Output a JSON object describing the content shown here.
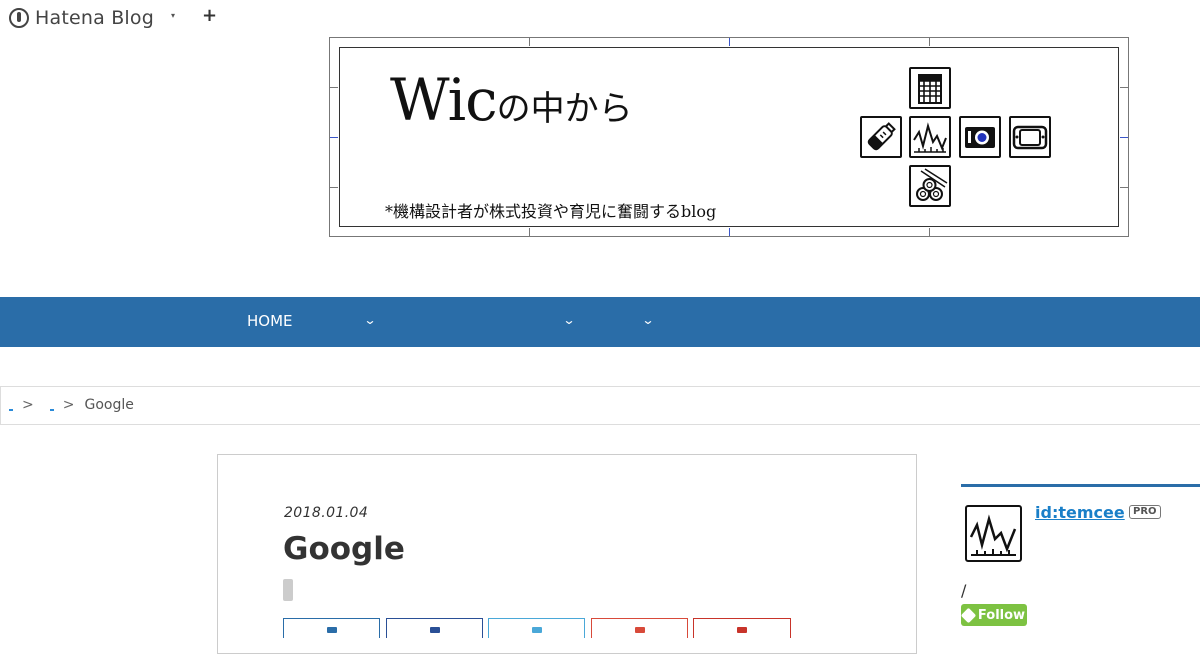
{
  "hatena_bar": {
    "logo_text": "Hatena Blog",
    "menu_caret": "▾",
    "add_symbol": "+"
  },
  "header": {
    "title_latin": "Wic",
    "title_japanese": "の中から",
    "subtitle": "*機構設計者が株式投資や育児に奮闘するblog",
    "icons": [
      "building-grid-icon",
      "baby-bottle-icon",
      "stock-chart-icon",
      "camera-icon",
      "game-console-icon",
      "wood-logs-icon"
    ]
  },
  "nav": {
    "home_label": "HOME",
    "caret": "⌄"
  },
  "breadcrumb": {
    "sep": ">",
    "current": "Google"
  },
  "article": {
    "date": "2018.01.04",
    "title": "Google"
  },
  "share_buttons": [
    {
      "color": "#2a6da8"
    },
    {
      "color": "#2a4f96"
    },
    {
      "color": "#4aa8d8"
    },
    {
      "color": "#d84a3a"
    },
    {
      "color": "#c8342a"
    }
  ],
  "sidebar": {
    "user_id": "id:temcee",
    "badge": "PRO",
    "slash": "/",
    "follow_label": "Follow",
    "avatar_icon": "stock-chart-icon"
  },
  "colors": {
    "nav_bg": "#2a6da8",
    "link": "#1a7fc8",
    "follow_bg": "#7dc242"
  }
}
